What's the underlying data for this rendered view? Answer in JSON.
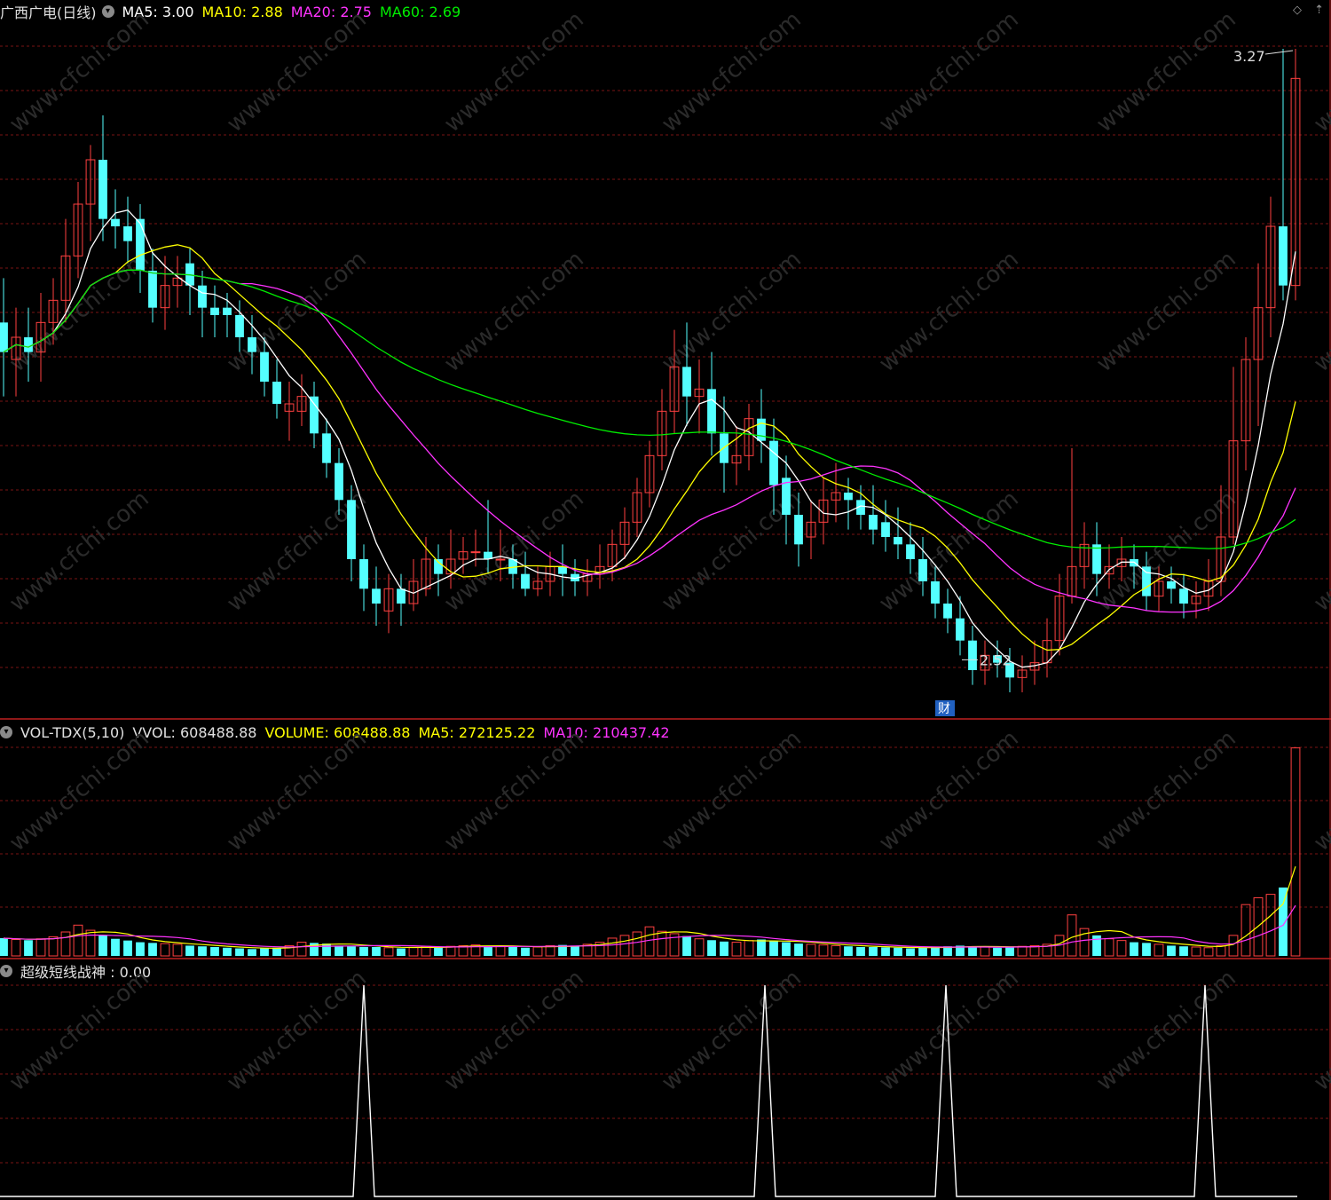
{
  "price_panel": {
    "stock_title": "广西广电(日线)",
    "ma_labels": [
      {
        "text": "MA5: 3.00",
        "color": "#ffffff"
      },
      {
        "text": "MA10: 2.88",
        "color": "#ffff00"
      },
      {
        "text": "MA20: 2.75",
        "color": "#ff33ff"
      },
      {
        "text": "MA60: 2.69",
        "color": "#00ee00"
      }
    ],
    "high_label": "3.27",
    "low_label": "2.52",
    "event_badge": "财"
  },
  "volume_panel": {
    "indicator_name": "VOL-TDX(5,10)",
    "vvol": "VVOL: 608488.88",
    "volume": "VOLUME: 608488.88",
    "ma5": "MA5: 272125.22",
    "ma10": "MA10: 210437.42"
  },
  "signal_panel": {
    "indicator_label": "超级短线战神 : 0.00"
  },
  "watermark": "www.cfchi.com",
  "colors": {
    "up": "#ff4040",
    "down": "#54ffff",
    "ma5": "#ffffff",
    "ma10": "#ffff00",
    "ma20": "#ff33ff",
    "ma60": "#00ee00",
    "grid": "#7a1515",
    "border": "#c02020"
  },
  "chart_data": {
    "type": "candlestick",
    "candles": [
      [
        2.9,
        2.86,
        2.96,
        2.8
      ],
      [
        2.85,
        2.88,
        2.92,
        2.8
      ],
      [
        2.88,
        2.86,
        2.92,
        2.82
      ],
      [
        2.86,
        2.9,
        2.94,
        2.82
      ],
      [
        2.9,
        2.93,
        2.96,
        2.87
      ],
      [
        2.93,
        2.99,
        3.04,
        2.9
      ],
      [
        2.99,
        3.06,
        3.09,
        2.96
      ],
      [
        3.06,
        3.12,
        3.14,
        3.01
      ],
      [
        3.12,
        3.04,
        3.18,
        3.01
      ],
      [
        3.04,
        3.03,
        3.08,
        3.0
      ],
      [
        3.03,
        3.01,
        3.07,
        2.98
      ],
      [
        3.04,
        2.97,
        3.06,
        2.94
      ],
      [
        2.97,
        2.92,
        3.0,
        2.9
      ],
      [
        2.92,
        2.95,
        2.99,
        2.89
      ],
      [
        2.95,
        2.96,
        2.99,
        2.92
      ],
      [
        2.98,
        2.95,
        3.0,
        2.91
      ],
      [
        2.95,
        2.92,
        2.97,
        2.88
      ],
      [
        2.92,
        2.91,
        2.95,
        2.88
      ],
      [
        2.92,
        2.91,
        2.94,
        2.88
      ],
      [
        2.91,
        2.88,
        2.93,
        2.86
      ],
      [
        2.88,
        2.86,
        2.91,
        2.83
      ],
      [
        2.86,
        2.82,
        2.88,
        2.8
      ],
      [
        2.82,
        2.79,
        2.85,
        2.77
      ],
      [
        2.78,
        2.79,
        2.82,
        2.74
      ],
      [
        2.78,
        2.8,
        2.83,
        2.76
      ],
      [
        2.8,
        2.75,
        2.82,
        2.73
      ],
      [
        2.75,
        2.71,
        2.77,
        2.69
      ],
      [
        2.71,
        2.66,
        2.73,
        2.64
      ],
      [
        2.66,
        2.58,
        2.68,
        2.55
      ],
      [
        2.58,
        2.54,
        2.6,
        2.51
      ],
      [
        2.54,
        2.52,
        2.57,
        2.49
      ],
      [
        2.51,
        2.54,
        2.56,
        2.48
      ],
      [
        2.54,
        2.52,
        2.56,
        2.49
      ],
      [
        2.52,
        2.55,
        2.58,
        2.51
      ],
      [
        2.54,
        2.58,
        2.61,
        2.53
      ],
      [
        2.58,
        2.56,
        2.6,
        2.53
      ],
      [
        2.56,
        2.58,
        2.62,
        2.54
      ],
      [
        2.58,
        2.59,
        2.61,
        2.56
      ],
      [
        2.59,
        2.59,
        2.62,
        2.57
      ],
      [
        2.59,
        2.58,
        2.66,
        2.56
      ],
      [
        2.58,
        2.58,
        2.62,
        2.55
      ],
      [
        2.58,
        2.56,
        2.6,
        2.54
      ],
      [
        2.56,
        2.54,
        2.59,
        2.53
      ],
      [
        2.54,
        2.55,
        2.57,
        2.53
      ],
      [
        2.55,
        2.57,
        2.59,
        2.53
      ],
      [
        2.57,
        2.56,
        2.6,
        2.53
      ],
      [
        2.56,
        2.55,
        2.58,
        2.53
      ],
      [
        2.55,
        2.56,
        2.58,
        2.53
      ],
      [
        2.56,
        2.57,
        2.6,
        2.54
      ],
      [
        2.57,
        2.6,
        2.62,
        2.55
      ],
      [
        2.6,
        2.63,
        2.65,
        2.58
      ],
      [
        2.63,
        2.67,
        2.69,
        2.61
      ],
      [
        2.67,
        2.72,
        2.74,
        2.65
      ],
      [
        2.72,
        2.78,
        2.81,
        2.7
      ],
      [
        2.78,
        2.84,
        2.89,
        2.75
      ],
      [
        2.84,
        2.8,
        2.9,
        2.76
      ],
      [
        2.8,
        2.81,
        2.85,
        2.75
      ],
      [
        2.81,
        2.75,
        2.86,
        2.72
      ],
      [
        2.75,
        2.71,
        2.8,
        2.67
      ],
      [
        2.71,
        2.72,
        2.76,
        2.68
      ],
      [
        2.72,
        2.77,
        2.79,
        2.7
      ],
      [
        2.77,
        2.74,
        2.81,
        2.71
      ],
      [
        2.74,
        2.68,
        2.77,
        2.64
      ],
      [
        2.69,
        2.64,
        2.72,
        2.6
      ],
      [
        2.64,
        2.6,
        2.67,
        2.57
      ],
      [
        2.61,
        2.63,
        2.66,
        2.58
      ],
      [
        2.63,
        2.66,
        2.69,
        2.6
      ],
      [
        2.66,
        2.67,
        2.71,
        2.63
      ],
      [
        2.67,
        2.66,
        2.69,
        2.62
      ],
      [
        2.66,
        2.64,
        2.68,
        2.62
      ],
      [
        2.64,
        2.62,
        2.68,
        2.6
      ],
      [
        2.63,
        2.61,
        2.66,
        2.59
      ],
      [
        2.61,
        2.6,
        2.65,
        2.58
      ],
      [
        2.6,
        2.58,
        2.63,
        2.56
      ],
      [
        2.58,
        2.55,
        2.61,
        2.53
      ],
      [
        2.55,
        2.52,
        2.57,
        2.5
      ],
      [
        2.52,
        2.5,
        2.54,
        2.48
      ],
      [
        2.5,
        2.47,
        2.53,
        2.45
      ],
      [
        2.47,
        2.43,
        2.49,
        2.41
      ],
      [
        2.43,
        2.45,
        2.47,
        2.41
      ],
      [
        2.45,
        2.44,
        2.47,
        2.42
      ],
      [
        2.44,
        2.42,
        2.46,
        2.4
      ],
      [
        2.42,
        2.43,
        2.45,
        2.4
      ],
      [
        2.43,
        2.44,
        2.47,
        2.41
      ],
      [
        2.44,
        2.47,
        2.5,
        2.42
      ],
      [
        2.47,
        2.53,
        2.56,
        2.45
      ],
      [
        2.53,
        2.57,
        2.73,
        2.52
      ],
      [
        2.57,
        2.6,
        2.63,
        2.54
      ],
      [
        2.6,
        2.56,
        2.63,
        2.53
      ],
      [
        2.56,
        2.57,
        2.6,
        2.54
      ],
      [
        2.57,
        2.58,
        2.61,
        2.55
      ],
      [
        2.58,
        2.57,
        2.6,
        2.54
      ],
      [
        2.57,
        2.53,
        2.59,
        2.51
      ],
      [
        2.53,
        2.55,
        2.57,
        2.51
      ],
      [
        2.55,
        2.54,
        2.57,
        2.52
      ],
      [
        2.54,
        2.52,
        2.56,
        2.5
      ],
      [
        2.52,
        2.53,
        2.55,
        2.5
      ],
      [
        2.53,
        2.55,
        2.58,
        2.51
      ],
      [
        2.55,
        2.61,
        2.68,
        2.53
      ],
      [
        2.61,
        2.74,
        2.84,
        2.6
      ],
      [
        2.74,
        2.85,
        2.88,
        2.7
      ],
      [
        2.85,
        2.92,
        2.98,
        2.76
      ],
      [
        2.92,
        3.03,
        3.07,
        2.88
      ],
      [
        3.03,
        2.95,
        3.27,
        2.93
      ],
      [
        2.95,
        3.23,
        3.27,
        2.93
      ]
    ],
    "volume": [
      52,
      48,
      46,
      50,
      56,
      70,
      90,
      75,
      60,
      50,
      45,
      40,
      38,
      36,
      34,
      30,
      28,
      26,
      24,
      22,
      20,
      22,
      24,
      30,
      40,
      38,
      36,
      30,
      28,
      26,
      26,
      24,
      22,
      25,
      28,
      26,
      28,
      30,
      32,
      30,
      28,
      26,
      24,
      26,
      30,
      32,
      30,
      34,
      40,
      52,
      60,
      70,
      85,
      72,
      65,
      58,
      50,
      46,
      42,
      40,
      45,
      48,
      44,
      40,
      36,
      34,
      32,
      30,
      28,
      26,
      26,
      25,
      24,
      22,
      24,
      26,
      28,
      30,
      28,
      26,
      24,
      26,
      28,
      30,
      34,
      60,
      120,
      80,
      60,
      50,
      45,
      40,
      38,
      34,
      30,
      28,
      26,
      24,
      30,
      60,
      150,
      170,
      180,
      200,
      608
    ]
  }
}
